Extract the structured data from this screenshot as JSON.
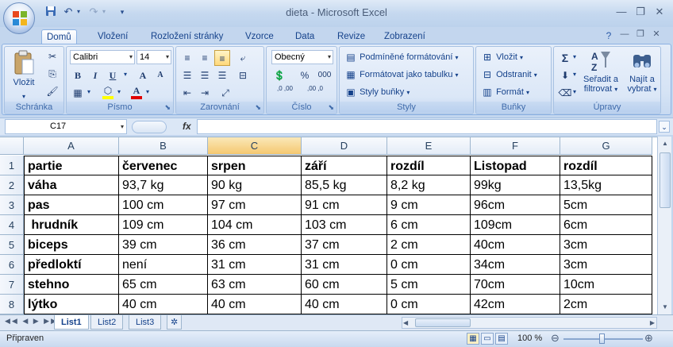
{
  "window": {
    "title": "dieta - Microsoft Excel"
  },
  "qat": {
    "save_icon": "save-icon",
    "undo_icon": "undo-icon",
    "redo_icon": "redo-icon",
    "customize_icon": "chevron-down-icon"
  },
  "tabs": [
    {
      "label": "Domů",
      "active": true
    },
    {
      "label": "Vložení"
    },
    {
      "label": "Rozložení stránky"
    },
    {
      "label": "Vzorce"
    },
    {
      "label": "Data"
    },
    {
      "label": "Revize"
    },
    {
      "label": "Zobrazení"
    }
  ],
  "ribbon": {
    "clipboard": {
      "label": "Schránka",
      "paste": "Vložit"
    },
    "font": {
      "label": "Písmo",
      "family": "Calibri",
      "size": "14",
      "bold": "B",
      "italic": "I",
      "underline": "U",
      "grow": "A",
      "shrink": "A"
    },
    "alignment": {
      "label": "Zarovnání"
    },
    "number": {
      "label": "Číslo",
      "format": "Obecný",
      "percent": "%",
      "thousands": "000",
      "inc_decimal": ",0 ,00",
      "dec_decimal": ",00 ,0"
    },
    "styles": {
      "label": "Styly",
      "conditional": "Podmíněné formátování",
      "table": "Formátovat jako tabulku",
      "cell_styles": "Styly buňky"
    },
    "cells": {
      "label": "Buňky",
      "insert": "Vložit",
      "delete": "Odstranit",
      "format": "Formát"
    },
    "editing": {
      "label": "Úpravy",
      "sum": "Σ",
      "sort_line1": "Seřadit a",
      "sort_line2": "filtrovat",
      "find_line1": "Najít a",
      "find_line2": "vybrat"
    }
  },
  "formula_bar": {
    "name_box": "C17",
    "fx": "fx",
    "formula": ""
  },
  "columns": [
    "A",
    "B",
    "C",
    "D",
    "E",
    "F",
    "G"
  ],
  "selected_column": "C",
  "rows": [
    {
      "n": "1",
      "cells": [
        "partie",
        "červenec",
        "srpen",
        "září",
        "rozdíl",
        "Listopad",
        "rozdíl"
      ]
    },
    {
      "n": "2",
      "cells": [
        "váha",
        "93,7 kg",
        "90 kg",
        "85,5 kg",
        "8,2 kg",
        "99kg",
        "13,5kg"
      ]
    },
    {
      "n": "3",
      "cells": [
        "pas",
        "100 cm",
        "97 cm",
        "91 cm",
        "9 cm",
        "96cm",
        "5cm"
      ]
    },
    {
      "n": "4",
      "cells": [
        " hrudník",
        "109 cm",
        "104 cm",
        "103 cm",
        "6 cm",
        "109cm",
        "6cm"
      ]
    },
    {
      "n": "5",
      "cells": [
        "biceps",
        "39 cm",
        "36 cm",
        "37 cm",
        "2 cm",
        "40cm",
        "3cm"
      ]
    },
    {
      "n": "6",
      "cells": [
        "předloktí",
        "není",
        "31 cm",
        "31 cm",
        "0 cm",
        "34cm",
        "3cm"
      ]
    },
    {
      "n": "7",
      "cells": [
        "stehno",
        "65 cm",
        "63 cm",
        "60 cm",
        "5 cm",
        "70cm",
        "10cm"
      ]
    },
    {
      "n": "8",
      "cells": [
        "lýtko",
        "40 cm",
        "40 cm",
        "40 cm",
        "0 cm",
        "42cm",
        "2cm"
      ]
    }
  ],
  "sheets": [
    {
      "label": "List1",
      "active": true
    },
    {
      "label": "List2"
    },
    {
      "label": "List3"
    }
  ],
  "status": {
    "text": "Připraven",
    "zoom": "100 %"
  },
  "colors": {
    "accent": "#15428b",
    "selection": "#f5c870",
    "ribbon": "#dbe7f7"
  }
}
